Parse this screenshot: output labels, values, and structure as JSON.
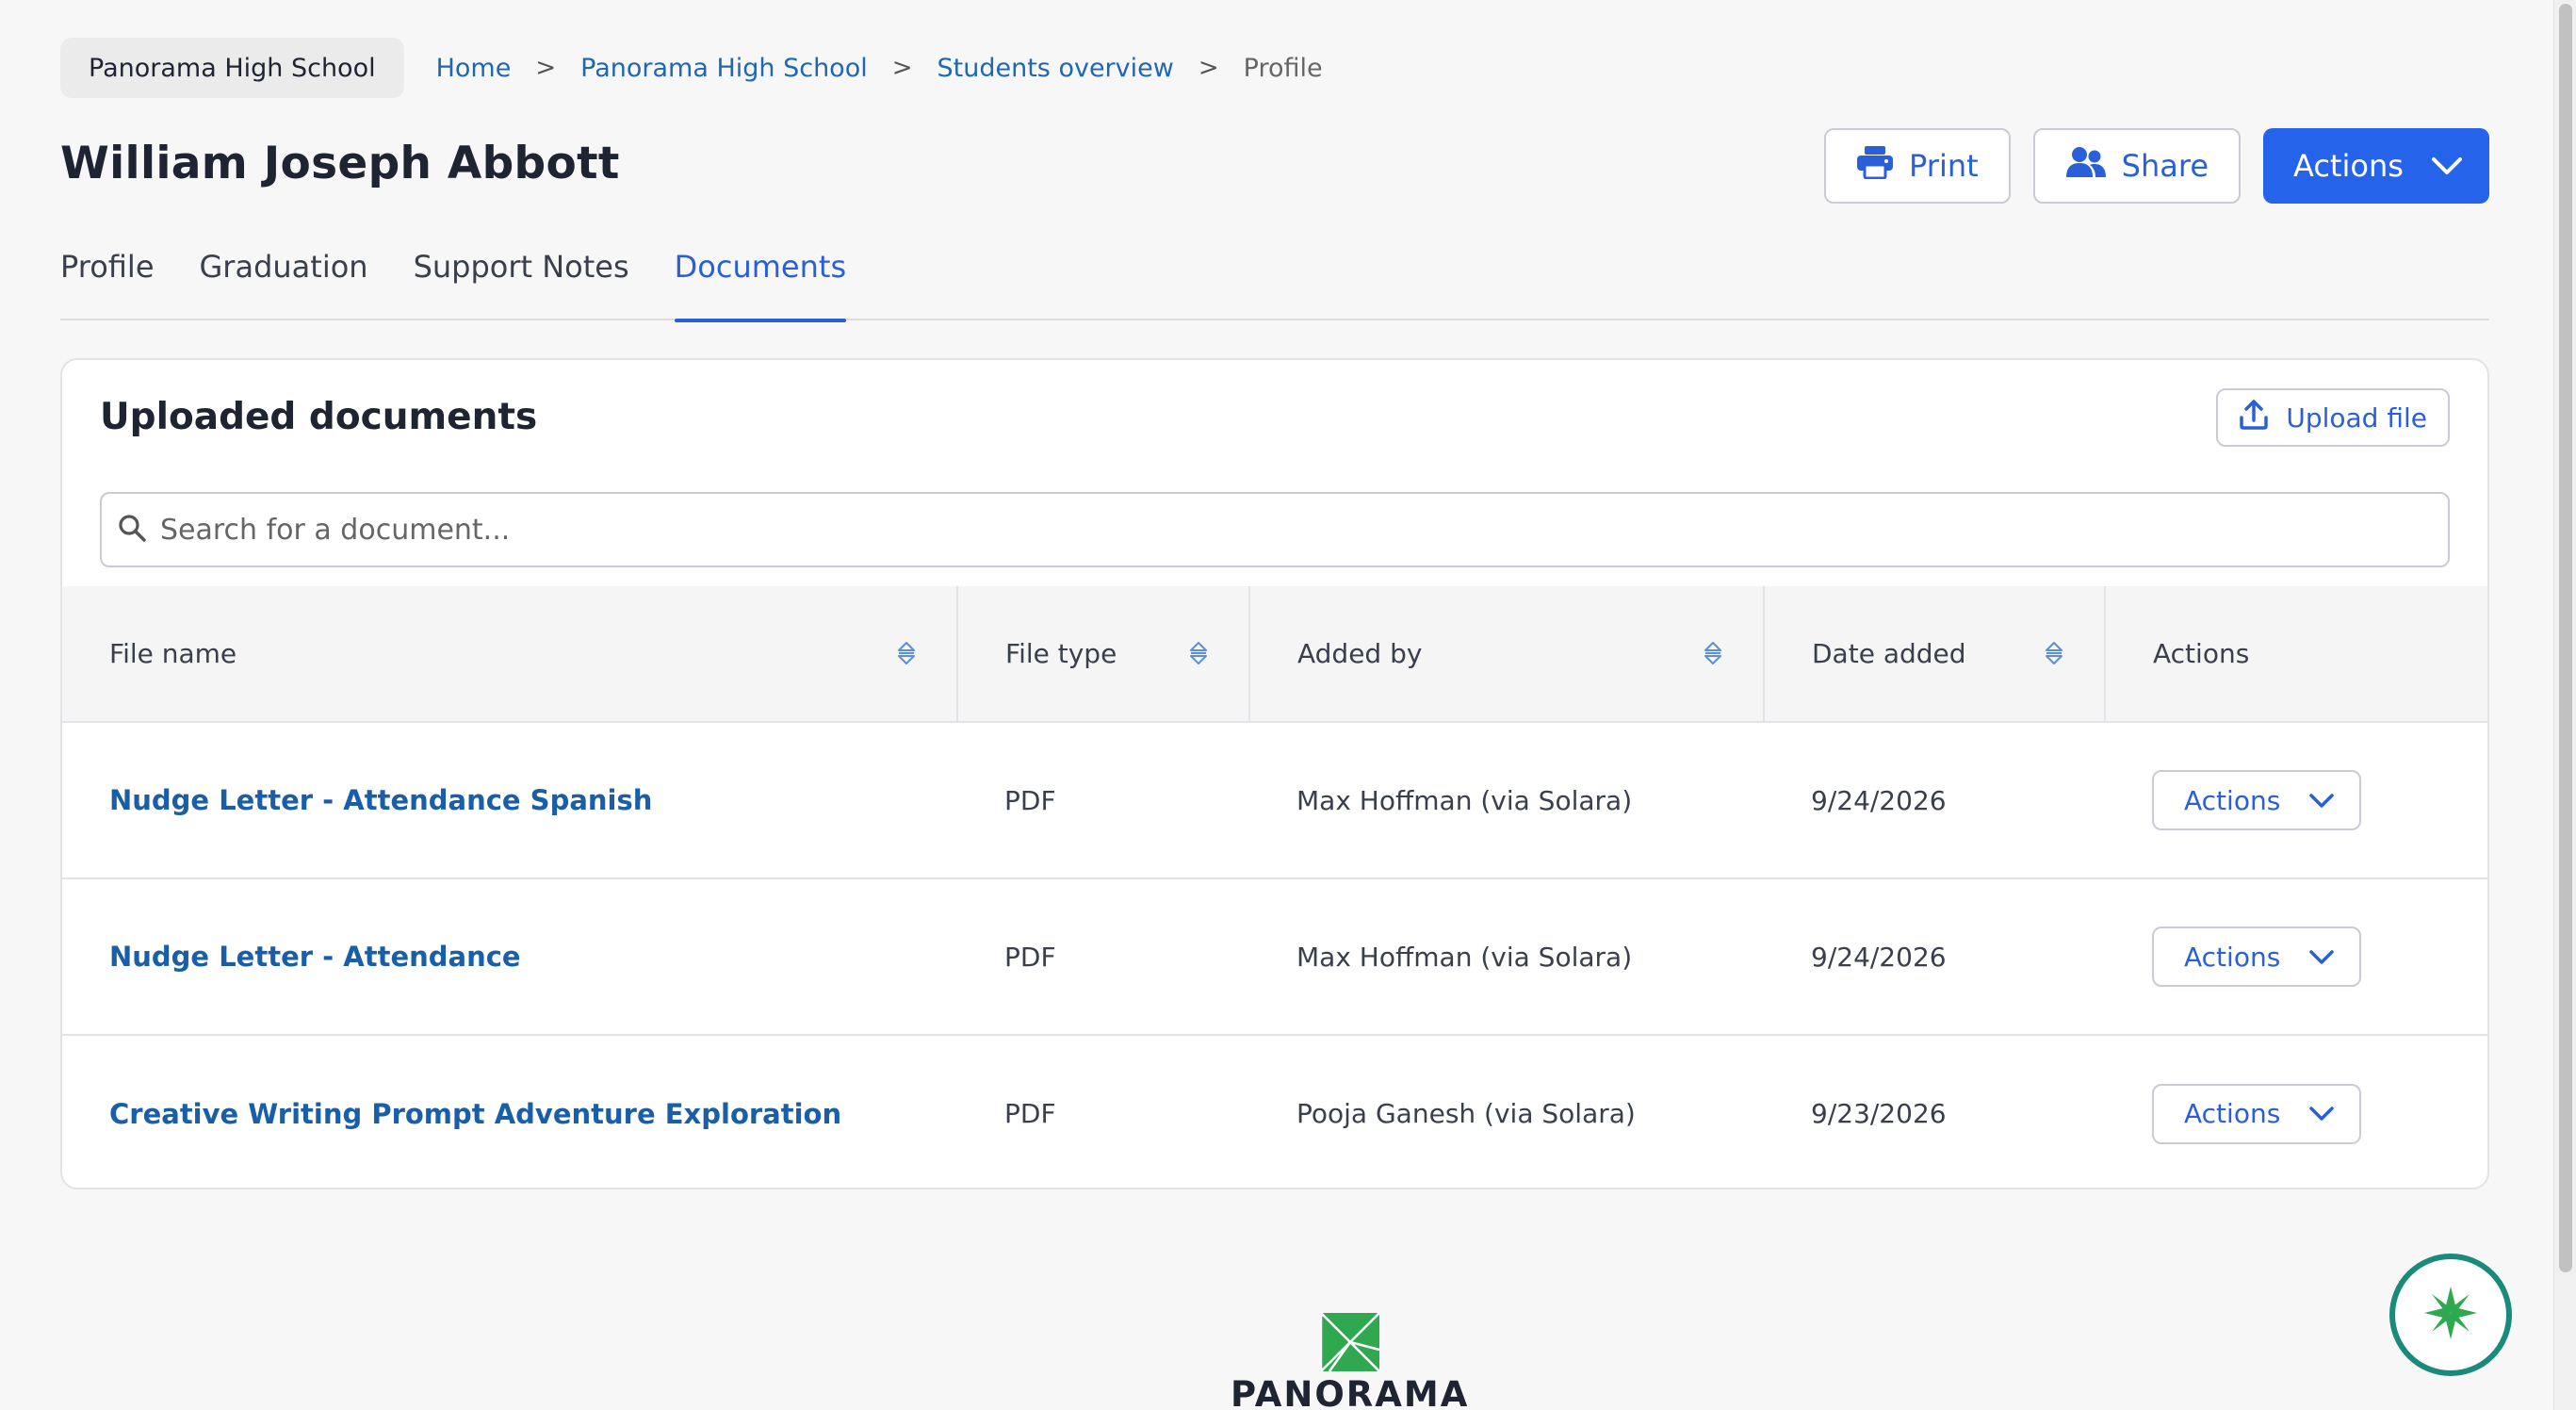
{
  "school_pill": "Panorama High School",
  "breadcrumb": {
    "home": "Home",
    "school": "Panorama High School",
    "students": "Students overview",
    "current": "Profile",
    "separator": ">"
  },
  "student_name": "William Joseph Abbott",
  "header_buttons": {
    "print": "Print",
    "share": "Share",
    "actions": "Actions"
  },
  "tabs": [
    {
      "label": "Profile",
      "active": false
    },
    {
      "label": "Graduation",
      "active": false
    },
    {
      "label": "Support Notes",
      "active": false
    },
    {
      "label": "Documents",
      "active": true
    }
  ],
  "documents": {
    "title": "Uploaded documents",
    "upload_label": "Upload file",
    "search_placeholder": "Search for a document...",
    "columns": [
      "File name",
      "File type",
      "Added by",
      "Date added",
      "Actions"
    ],
    "rows": [
      {
        "name": "Nudge Letter - Attendance Spanish",
        "type": "PDF",
        "added_by": "Max Hoffman (via Solara)",
        "date": "9/24/2026",
        "action": "Actions"
      },
      {
        "name": "Nudge Letter - Attendance",
        "type": "PDF",
        "added_by": "Max Hoffman (via Solara)",
        "date": "9/24/2026",
        "action": "Actions"
      },
      {
        "name": "Creative Writing Prompt Adventure Exploration",
        "type": "PDF",
        "added_by": "Pooja Ganesh (via Solara)",
        "date": "9/23/2026",
        "action": "Actions"
      }
    ]
  },
  "footer": {
    "logo_text": "PANORAMA"
  },
  "colors": {
    "accent": "#2563eb",
    "link": "#1a5ea8",
    "logo_green": "#2fa84f",
    "fab_ring": "#1a8a7a"
  }
}
